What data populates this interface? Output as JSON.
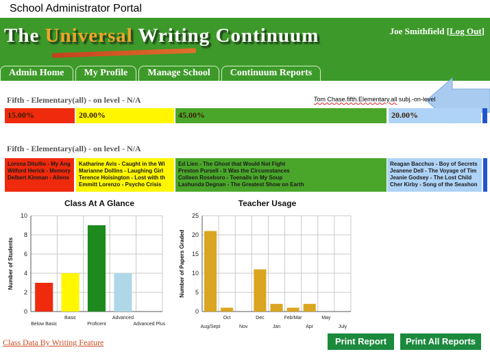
{
  "caption": "School Administrator Portal",
  "header": {
    "logo": {
      "the": "The",
      "universal": "Universal",
      "writing": "Writing",
      "continuum": "Continuum"
    },
    "user_name": "Joe Smithfield",
    "bracket_open": "[",
    "logout_label": "Log Out",
    "bracket_close": "]"
  },
  "tabs": [
    {
      "label": "Admin Home"
    },
    {
      "label": "My Profile"
    },
    {
      "label": "Manage School"
    },
    {
      "label": "Continuum Reports"
    }
  ],
  "colors": {
    "red": "#ef2a0d",
    "yellow": "#fff600",
    "green": "#4aa62a",
    "blue": "#aed3f7",
    "accent_blue": "#2255cc",
    "brand_green": "#3d9a2a"
  },
  "summary": {
    "title": "Fifth - Elementary(all) - on level - N/A",
    "pointer_text_main": "Tom Chase.fifth.Elementary.all",
    "pointer_text_tail": " subj.-on-level",
    "segments": [
      {
        "label": "15.00%",
        "value": 15.0
      },
      {
        "label": "20.00%",
        "value": 20.0
      },
      {
        "label": "45.00%",
        "value": 45.0
      },
      {
        "label": "20.00%",
        "value": 20.0
      }
    ]
  },
  "students": {
    "title": "Fifth - Elementary(all) - on level - N/A",
    "groups": [
      {
        "level": "Below Basic",
        "names": [
          "Lorena Ditullio - My Ang",
          "Wilford Herick - Memory",
          "Delbert Kinman - Aliens"
        ]
      },
      {
        "level": "Basic",
        "names": [
          "Katharine Avis - Caught in the Wi",
          "Marianne Dollins - Laughing Girl",
          "Terence Hoisington - Lost with th",
          "Emmitt Lorenzo - Psycho Crisis"
        ]
      },
      {
        "level": "Proficient",
        "names": [
          "Ed Lien - The Ghost that Would Not Fight",
          "Preston Pursell - It Was the Circumstances",
          "Colleen Roseboro - Toenails in My Soup",
          "Lashunda Degnan - The Greatest Show on Earth"
        ]
      },
      {
        "level": "Advanced",
        "names": [
          "Reagan Bacchus - Boy of Secrets",
          "Jeanene Dell - The Voyage of Tim",
          "Jeanie Godsey - The Lost Child",
          "Cher Kirby - Song of the Seashon"
        ]
      }
    ]
  },
  "chart_data": [
    {
      "type": "bar",
      "title": "Class At A Glance",
      "ylabel": "Number of Students",
      "xlabel": "",
      "categories": [
        "Below Basic",
        "Basic",
        "Proficent",
        "Advanced",
        "Advanced Plus"
      ],
      "values": [
        3,
        4,
        9,
        4,
        0
      ],
      "colors": [
        "#ef2a0d",
        "#fff600",
        "#1e8a1e",
        "#aed8e8",
        "#cccccc"
      ],
      "ylim": [
        0,
        10
      ],
      "yticks": [
        0,
        2,
        4,
        6,
        8,
        10
      ],
      "grid": true
    },
    {
      "type": "bar",
      "title": "Teacher Usage",
      "ylabel": "Number of Papers Graded",
      "xlabel": "",
      "categories": [
        "Aug/Sept",
        "Oct",
        "Nov",
        "Dec",
        "Jan",
        "Feb/Mar",
        "Apr",
        "May",
        "July"
      ],
      "values": [
        21,
        1,
        0,
        11,
        2,
        1,
        2,
        0,
        0
      ],
      "colors": [
        "#daa520"
      ],
      "ylim": [
        0,
        25
      ],
      "yticks": [
        0,
        5,
        10,
        15,
        20,
        25
      ],
      "grid": true
    }
  ],
  "footer": {
    "link_label": "Class Data By Writing Feature",
    "print_label": "Print Report",
    "print_all_label": "Print All Reports"
  }
}
